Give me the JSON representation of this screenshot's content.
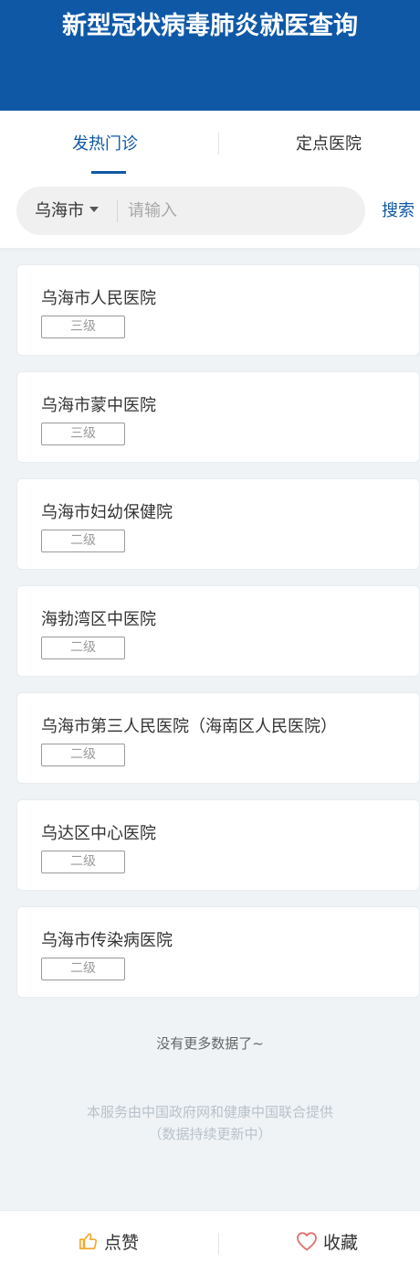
{
  "header": {
    "title": "新型冠状病毒肺炎就医查询"
  },
  "tabs": [
    {
      "label": "发热门诊",
      "active": true
    },
    {
      "label": "定点医院",
      "active": false
    }
  ],
  "search": {
    "city": "乌海市",
    "placeholder": "请输入",
    "button_label": "搜索"
  },
  "hospitals": [
    {
      "name": "乌海市人民医院",
      "level": "三级"
    },
    {
      "name": "乌海市蒙中医院",
      "level": "三级"
    },
    {
      "name": "乌海市妇幼保健院",
      "level": "二级"
    },
    {
      "name": "海勃湾区中医院",
      "level": "二级"
    },
    {
      "name": "乌海市第三人民医院（海南区人民医院）",
      "level": "二级"
    },
    {
      "name": "乌达区中心医院",
      "level": "二级"
    },
    {
      "name": "乌海市传染病医院",
      "level": "二级"
    }
  ],
  "list_end": "没有更多数据了~",
  "footer": {
    "line1": "本服务由中国政府网和健康中国联合提供",
    "line2": "（数据持续更新中）"
  },
  "bottom_bar": {
    "like_label": "点赞",
    "favorite_label": "收藏",
    "like_icon": "thumbs-up-icon",
    "favorite_icon": "heart-icon"
  },
  "colors": {
    "brand": "#0f58a6",
    "like_icon": "#f0a830",
    "favorite_icon": "#e0706f"
  }
}
